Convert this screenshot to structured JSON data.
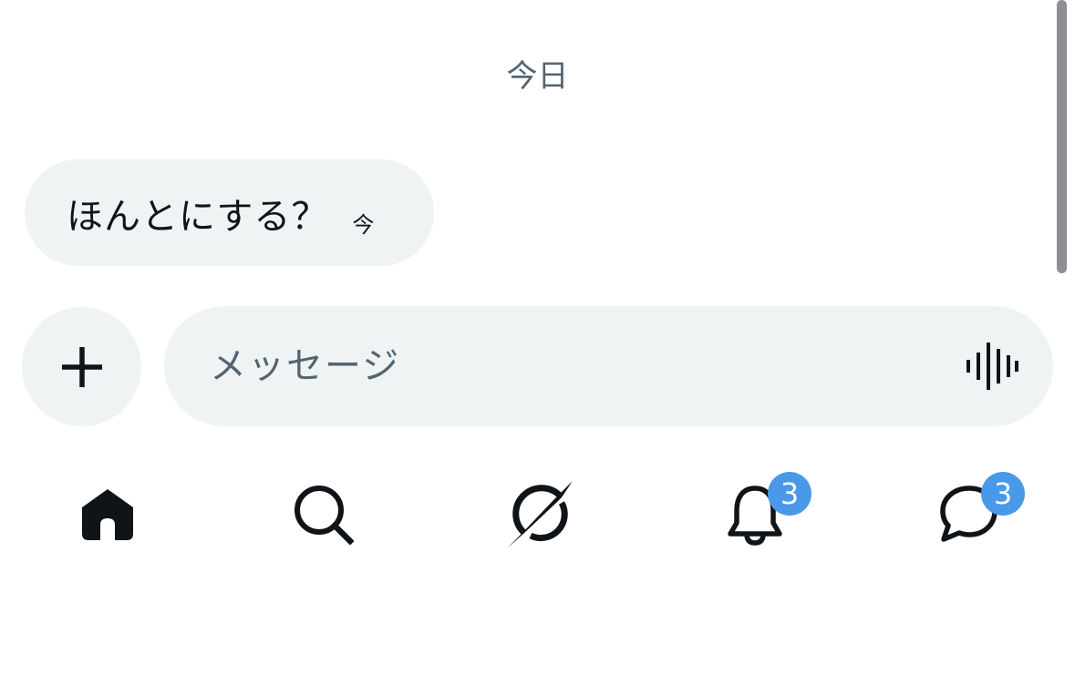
{
  "conversation": {
    "date_divider": "今日",
    "messages": [
      {
        "text": "ほんとにする？",
        "time": "今"
      }
    ]
  },
  "composer": {
    "add_icon": "plus-icon",
    "placeholder": "メッセージ",
    "voice_icon": "audio-waveform-icon"
  },
  "tabbar": {
    "tabs": [
      {
        "name": "home",
        "icon": "home-icon",
        "active": true
      },
      {
        "name": "search",
        "icon": "search-icon"
      },
      {
        "name": "grok",
        "icon": "grok-icon"
      },
      {
        "name": "notifications",
        "icon": "bell-icon",
        "badge": "3"
      },
      {
        "name": "messages",
        "icon": "chat-bubble-icon",
        "badge": "3"
      }
    ]
  },
  "colors": {
    "bubble_bg": "#eff3f4",
    "secondary_text": "#536471",
    "primary_text": "#0f1419",
    "badge": "#4a99e9"
  }
}
